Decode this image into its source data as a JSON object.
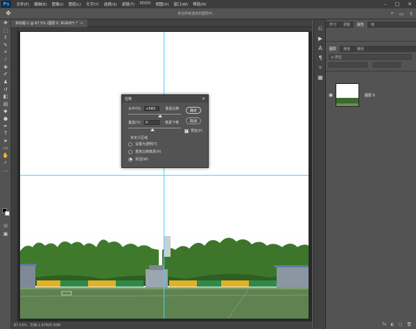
{
  "app": {
    "logo": "Ps"
  },
  "menu": [
    "文件(F)",
    "编辑(E)",
    "图像(I)",
    "图层(L)",
    "文字(Y)",
    "选择(S)",
    "滤镜(T)",
    "3D(D)",
    "视图(V)",
    "窗口(W)",
    "帮助(H)"
  ],
  "window_controls": [
    "–",
    "□",
    "✕"
  ],
  "options_bar": {
    "hint": "未在所有选定的图层中..."
  },
  "document_tab": {
    "label": "未标题-1 @ 87.5% (图层 0, RGB/8*) *",
    "close": "×"
  },
  "status_bar": {
    "zoom": "87.53%",
    "doc_info": "文档:1.67M/5.50M"
  },
  "right_panels": {
    "top_tabs": [
      "学习",
      "调整",
      "属性",
      "库"
    ],
    "layers_tabs": [
      "图层",
      "通道",
      "路径"
    ],
    "filter_placeholder": "p 类型",
    "layer": {
      "name": "图层 0"
    },
    "panel_bottom_icons": [
      "fx",
      "◐",
      "▢",
      "🗑"
    ]
  },
  "dialog": {
    "title": "位移",
    "horizontal_label": "水平(H):",
    "horizontal_value": "+582",
    "horizontal_unit": "像素右移",
    "vertical_label": "垂直(V):",
    "vertical_value": "0",
    "vertical_unit": "像素下移",
    "ok_label": "确定",
    "cancel_label": "取消",
    "preview_label": "预览(P)",
    "undefined_area_label": "未定义区域",
    "options": [
      "设置为透明(T)",
      "重复边缘像素(R)",
      "折回(W)"
    ],
    "selected_option_index": 2
  },
  "colors": {
    "guide": "#3fd6ff",
    "panel": "#535353",
    "menubar": "#3c3c3c"
  }
}
